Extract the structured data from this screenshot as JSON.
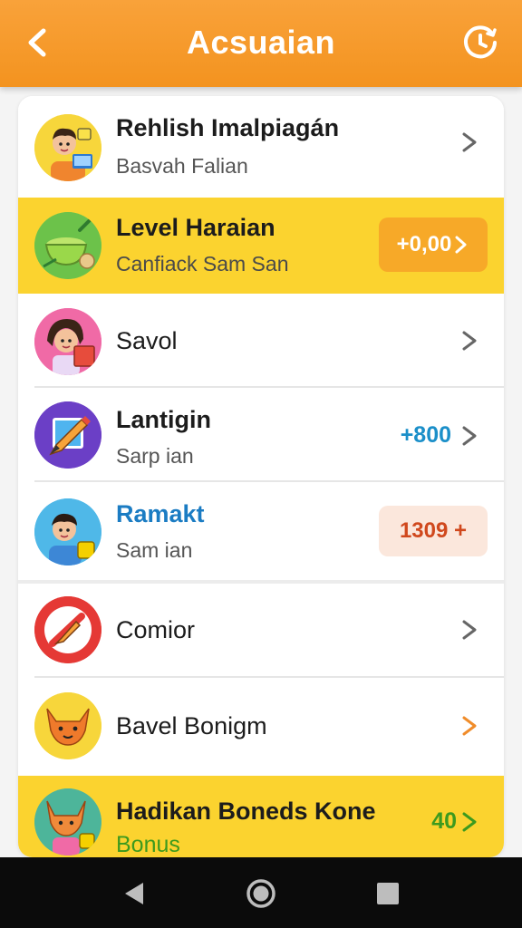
{
  "header": {
    "title": "Acsuaian",
    "back_icon": "chevron-left-icon",
    "history_icon": "clock-history-icon"
  },
  "items": [
    {
      "title": "Rehlish Imalpiagán",
      "subtitle": "Basvah Falian",
      "icon": "boy-laptop-avatar"
    },
    {
      "title": "Level Haraian",
      "subtitle": "Canfiack Sam San",
      "badge": "+0,00",
      "icon": "bowl-avatar",
      "highlighted": true
    },
    {
      "title": "Savol",
      "icon": "girl-book-avatar"
    },
    {
      "title": "Lantigin",
      "subtitle": "Sarp ian",
      "value": "+800",
      "icon": "pencil-avatar"
    },
    {
      "title": "Ramakt",
      "subtitle": "Sam ian",
      "badge": "1309 +",
      "icon": "boy-badge-avatar"
    },
    {
      "title": "Comior",
      "icon": "no-draw-avatar"
    },
    {
      "title": "Bavel Bonigm",
      "icon": "fox-avatar"
    },
    {
      "title": "Hadikan Boneds Kone",
      "subtitle": "Bonus",
      "value": "40",
      "icon": "fox-girl-avatar",
      "highlighted": true
    }
  ],
  "colors": {
    "header": "#f3931f",
    "highlight": "#fbd32f",
    "blue_value": "#1b8fc9",
    "green_value": "#3d9a1e",
    "badge_orange": "#f7a928",
    "badge_peach": "#fbe7dc"
  },
  "navbar": {
    "back": "triangle-back-icon",
    "home": "circle-home-icon",
    "recents": "square-recents-icon"
  }
}
